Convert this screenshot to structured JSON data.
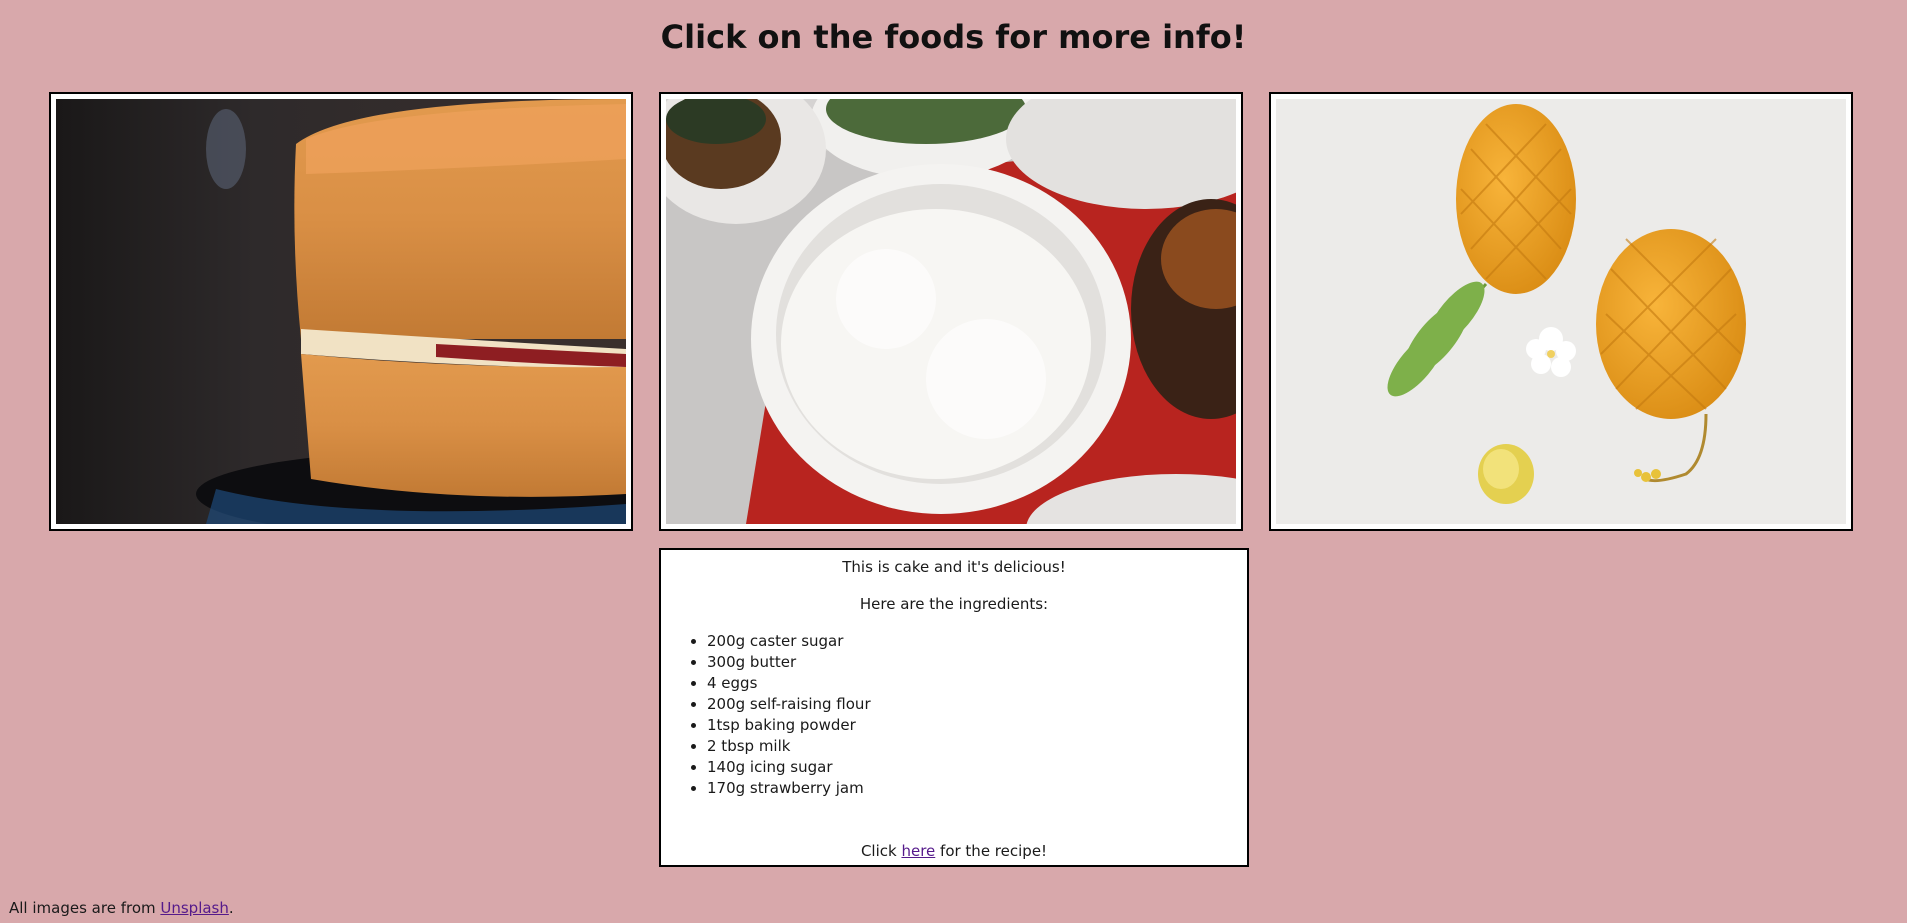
{
  "page": {
    "title": "Click on the foods for more info!"
  },
  "cards": [
    {
      "name": "cake",
      "image": "cake-photo"
    },
    {
      "name": "rice",
      "image": "rice-photo"
    },
    {
      "name": "mango",
      "image": "mango-photo"
    }
  ],
  "info": {
    "line1": "This is cake and it's delicious!",
    "line2": "Here are the ingredients:",
    "ingredients": [
      "200g caster sugar",
      "300g butter",
      "4 eggs",
      "200g self-raising flour",
      "1tsp baking powder",
      "2 tbsp milk",
      "140g icing sugar",
      "170g strawberry jam"
    ],
    "recipe_prefix": "Click ",
    "recipe_link": "here",
    "recipe_suffix": " for the recipe!"
  },
  "footer": {
    "prefix": "All images are from ",
    "link": "Unsplash",
    "suffix": "."
  },
  "colors": {
    "background": "#d8a8ab",
    "link": "#551a8b"
  }
}
